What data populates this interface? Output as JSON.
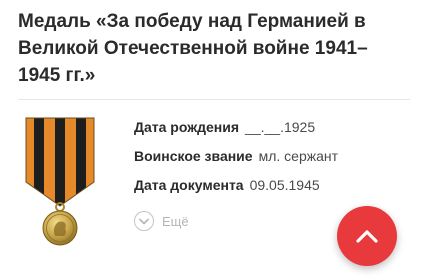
{
  "award": {
    "title": "Медаль «За победу над Германией в Великой Отечественной войне 1941–1945 гг.»"
  },
  "details": [
    {
      "label": "Дата рождения",
      "value": "__.__.1925"
    },
    {
      "label": "Воинское звание",
      "value": "мл. сержант"
    },
    {
      "label": "Дата документа",
      "value": "09.05.1945"
    }
  ],
  "more": {
    "label": "Ещё",
    "icon": "chevron-down-icon"
  },
  "scroll_top": {
    "icon": "chevron-up-icon"
  },
  "colors": {
    "accent": "#e8393c",
    "ribbon_orange": "#e5892a",
    "ribbon_black": "#1e1e1e",
    "medal_gold": "#c9a64a"
  }
}
